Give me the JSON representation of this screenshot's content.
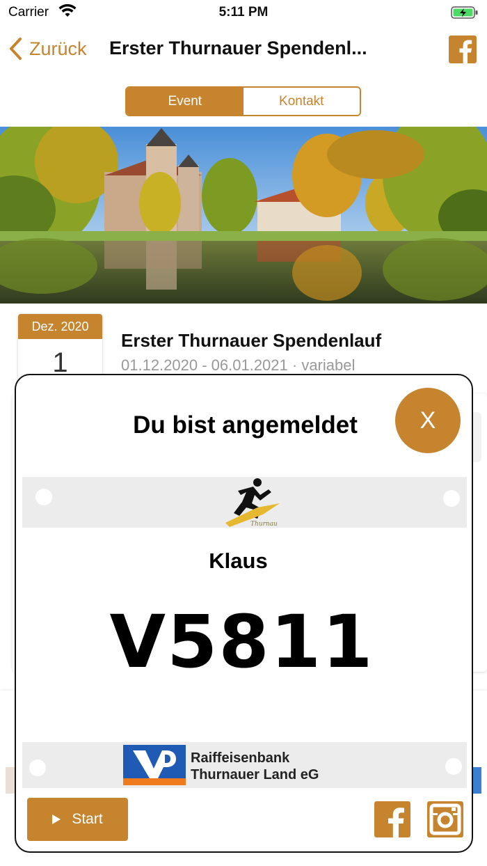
{
  "status_bar": {
    "carrier": "Carrier",
    "time": "5:11 PM",
    "wifi_icon": "wifi-icon",
    "battery_icon": "battery-charging-icon"
  },
  "nav": {
    "back_label": "Zurück",
    "title": "Erster Thurnauer Spendenl...",
    "share_icon": "facebook-icon"
  },
  "segments": {
    "event": "Event",
    "contact": "Kontakt"
  },
  "event": {
    "month_year": "Dez. 2020",
    "day": "1",
    "title": "Erster Thurnauer Spendenlauf",
    "dates": "01.12.2020 - 06.01.2021 · variabel"
  },
  "modal": {
    "title": "Du bist angemeldet",
    "close_label": "X",
    "runner_name": "Klaus",
    "bib_number": "V5811",
    "sponsor_line1": "Raiffeisenbank",
    "sponsor_line2": "Thurnauer Land eG",
    "start_label": "Start",
    "footer_icons": [
      "facebook-icon",
      "instagram-icon"
    ]
  },
  "colors": {
    "accent": "#c6842f",
    "bib_background": "#ececec",
    "bank_blue": "#1f5bb5",
    "bank_orange": "#f07a1e"
  }
}
